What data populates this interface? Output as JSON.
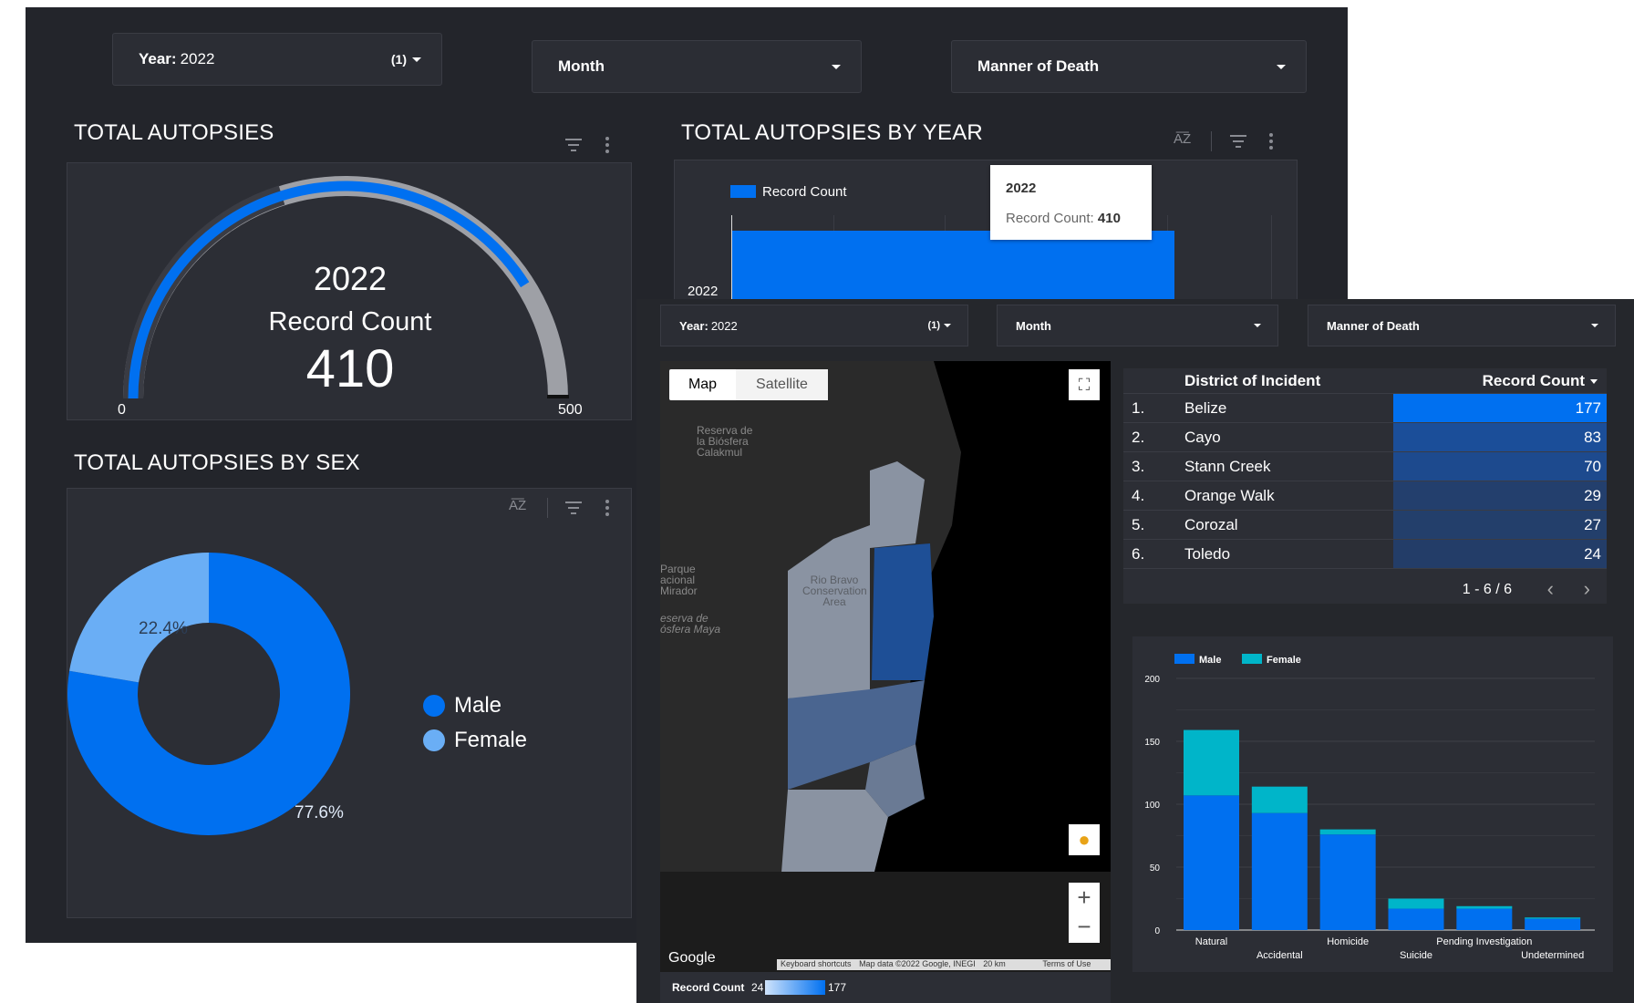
{
  "filters": {
    "year_label": "Year:",
    "year_value": "2022",
    "year_count": "(1)",
    "month_label": "Month",
    "manner_label": "Manner of Death"
  },
  "total": {
    "title": "TOTAL AUTOPSIES",
    "year": "2022",
    "metric": "Record Count",
    "value": "410",
    "min": "0",
    "max": "500",
    "progress": 0.82
  },
  "by_year": {
    "title": "TOTAL AUTOPSIES BY YEAR",
    "legend": "Record Count",
    "y_label": "2022",
    "tooltip_title": "2022",
    "tooltip_key": "Record Count:",
    "tooltip_value": "410"
  },
  "by_sex": {
    "title": "TOTAL AUTOPSIES BY SEX",
    "male_pct": "77.6%",
    "female_pct": "22.4%",
    "legend_male": "Male",
    "legend_female": "Female"
  },
  "map": {
    "btn_map": "Map",
    "btn_satellite": "Satellite",
    "label_reserva": "Reserva de la Biósfera Calakmul",
    "label_rio_bravo": "Rio Bravo Conservation Area",
    "label_parque": "Parque acional Mirador",
    "label_reserva_maya": "eserva de ósfera Maya",
    "google": "Google",
    "footer_shortcuts": "Keyboard shortcuts",
    "footer_data": "Map data ©2022 Google, INEGI",
    "footer_scale": "20 km",
    "footer_terms": "Terms of Use",
    "legend_label": "Record Count",
    "legend_min": "24",
    "legend_max": "177"
  },
  "district_table": {
    "col1": "District of Incident",
    "col2": "Record Count",
    "rows": [
      {
        "n": "1.",
        "name": "Belize",
        "value": "177"
      },
      {
        "n": "2.",
        "name": "Cayo",
        "value": "83"
      },
      {
        "n": "3.",
        "name": "Stann Creek",
        "value": "70"
      },
      {
        "n": "4.",
        "name": "Orange Walk",
        "value": "29"
      },
      {
        "n": "5.",
        "name": "Corozal",
        "value": "27"
      },
      {
        "n": "6.",
        "name": "Toledo",
        "value": "24"
      }
    ],
    "pagination": "1 - 6 / 6"
  },
  "colors": {
    "primary": "#0070f0",
    "light_blue": "#6aaef5",
    "teal": "#00b5c9",
    "background": "#23252b"
  },
  "chart_data": {
    "type": "bar",
    "stacked": true,
    "categories": [
      "Natural",
      "Accidental",
      "Homicide",
      "Suicide",
      "Pending Investigation",
      "Undetermined"
    ],
    "series": [
      {
        "name": "Male",
        "values": [
          107,
          93,
          76,
          17,
          17,
          9
        ]
      },
      {
        "name": "Female",
        "values": [
          52,
          21,
          4,
          8,
          2,
          1
        ]
      }
    ],
    "ylim": [
      0,
      200
    ],
    "yticks": [
      "0",
      "50",
      "100",
      "150",
      "200"
    ],
    "legend_position": "top-left",
    "grid": true
  }
}
